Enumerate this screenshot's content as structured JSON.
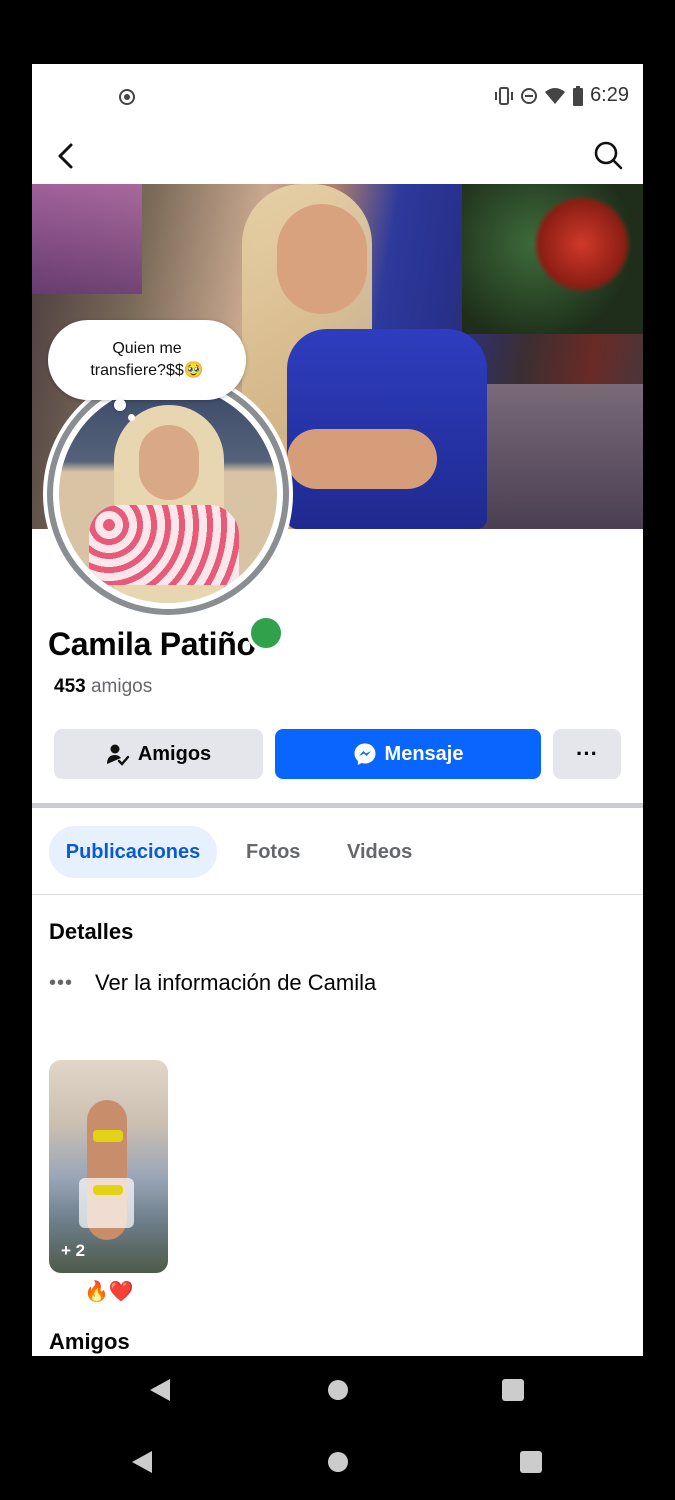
{
  "status_bar": {
    "time": "6:29"
  },
  "profile": {
    "name": "Camila Patiño",
    "friends_count": "453",
    "friends_label": "amigos",
    "note": {
      "line1": "Quien me",
      "line2": "transfiere?$$🥹"
    },
    "online": true
  },
  "actions": {
    "friends_button": "Amigos",
    "message_button": "Mensaje",
    "more_button": "···"
  },
  "tabs": [
    {
      "label": "Publicaciones",
      "active": true
    },
    {
      "label": "Fotos",
      "active": false
    },
    {
      "label": "Videos",
      "active": false
    }
  ],
  "details": {
    "heading": "Detalles",
    "info_link": "Ver la información de Camila",
    "info_dots": "•••"
  },
  "highlight": {
    "count": "+ 2",
    "emoji": "🔥❤️"
  },
  "friends_section": {
    "heading": "Amigos"
  },
  "colors": {
    "primary": "#0866ff",
    "active_tab_bg": "#e7f0fd",
    "online": "#31a24c"
  },
  "icons": [
    "back-arrow-icon",
    "search-icon",
    "person-check-icon",
    "messenger-icon",
    "more-icon",
    "cast-icon",
    "vibrate-icon",
    "dnd-icon",
    "wifi-icon",
    "battery-icon"
  ]
}
